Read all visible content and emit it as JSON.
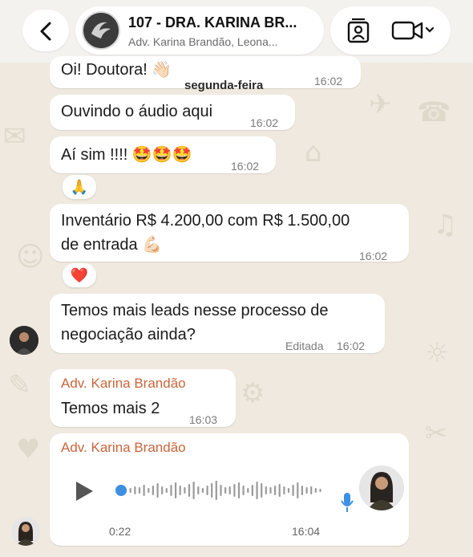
{
  "header": {
    "title": "107 - DRA. KARINA BR...",
    "subtitle": "Adv. Karina Brandão, Leona..."
  },
  "date_separator": "segunda-feira",
  "messages": [
    {
      "text": "Oi! Doutora! 👋🏻",
      "time": "16:02"
    },
    {
      "text": "Ouvindo o áudio aqui",
      "time": "16:02"
    },
    {
      "text": "Aí sim !!!! 🤩🤩🤩",
      "time": "16:02"
    },
    {
      "reaction": "🙏"
    },
    {
      "line1": "Inventário R$ 4.200,00 com R$ 1.500,00",
      "line2": "de entrada 💪🏻",
      "time": "16:02"
    },
    {
      "reaction": "❤️"
    },
    {
      "line1": "Temos mais leads nesse processo de",
      "line2": "negociação ainda?",
      "edited": "Editada",
      "time": "16:02"
    },
    {
      "sender": "Adv. Karina Brandão",
      "text": "Temos mais 2",
      "time": "16:03"
    }
  ],
  "audio": {
    "sender": "Adv. Karina Brandão",
    "duration": "0:22",
    "time": "16:04",
    "progress": 0
  },
  "colors": {
    "sender": "#c8653a",
    "background": "#efe9df",
    "bubble": "#ffffff",
    "mic": "#3d8fe0"
  }
}
